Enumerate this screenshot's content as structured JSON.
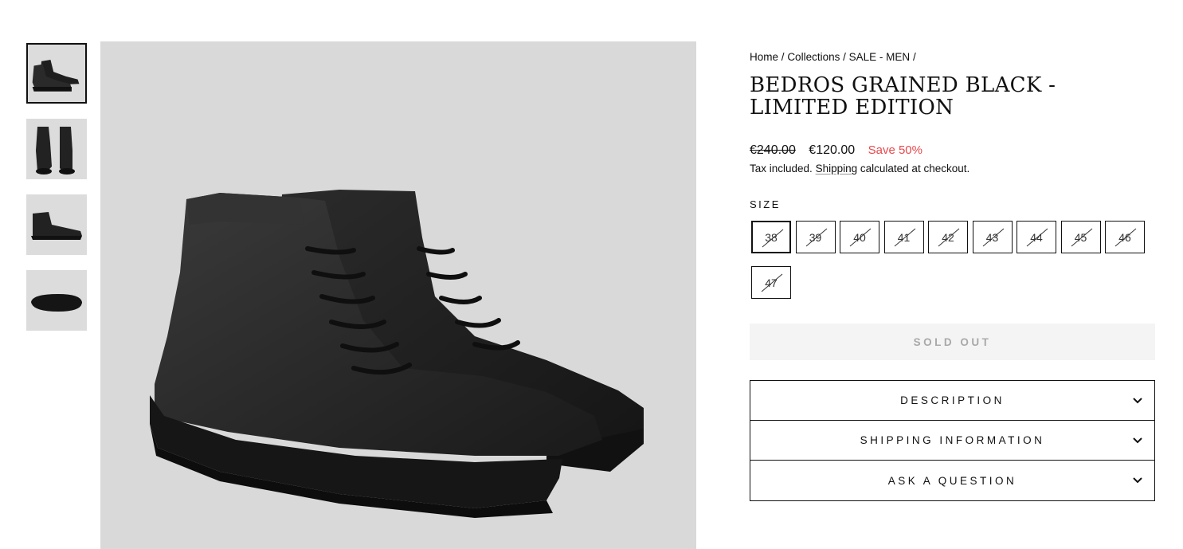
{
  "gallery": {
    "thumbnails": [
      {
        "view": "pair-side",
        "selected": true
      },
      {
        "view": "pair-front",
        "selected": false
      },
      {
        "view": "single-side",
        "selected": false
      },
      {
        "view": "sole",
        "selected": false
      }
    ]
  },
  "product": {
    "breadcrumb": [
      "Home",
      "Collections",
      "SALE - MEN"
    ],
    "breadcrumb_separator": "/",
    "title": "BEDROS GRAINED BLACK - LIMITED EDITION",
    "price_original": "€240.00",
    "price_sale": "€120.00",
    "save_text": "Save 50%",
    "tax_prefix": "Tax included.",
    "tax_link": "Shipping",
    "tax_suffix": "calculated at checkout.",
    "size_label": "SIZE",
    "sizes": [
      {
        "label": "38",
        "selected": true,
        "available": false
      },
      {
        "label": "39",
        "selected": false,
        "available": false
      },
      {
        "label": "40",
        "selected": false,
        "available": false
      },
      {
        "label": "41",
        "selected": false,
        "available": false
      },
      {
        "label": "42",
        "selected": false,
        "available": false
      },
      {
        "label": "43",
        "selected": false,
        "available": false
      },
      {
        "label": "44",
        "selected": false,
        "available": false
      },
      {
        "label": "45",
        "selected": false,
        "available": false
      },
      {
        "label": "46",
        "selected": false,
        "available": false
      },
      {
        "label": "47",
        "selected": false,
        "available": false
      }
    ],
    "sold_out_label": "SOLD OUT",
    "accordion": [
      {
        "label": "DESCRIPTION",
        "icon": "chevron-down-icon"
      },
      {
        "label": "SHIPPING INFORMATION",
        "icon": "chevron-down-icon"
      },
      {
        "label": "ASK A QUESTION",
        "icon": "chevron-down-icon"
      }
    ]
  },
  "colors": {
    "sale_accent": "#e8484c",
    "image_background": "#d9d9d9",
    "sold_out_background": "#f4f4f4",
    "sold_out_text": "#a9a9a9"
  }
}
